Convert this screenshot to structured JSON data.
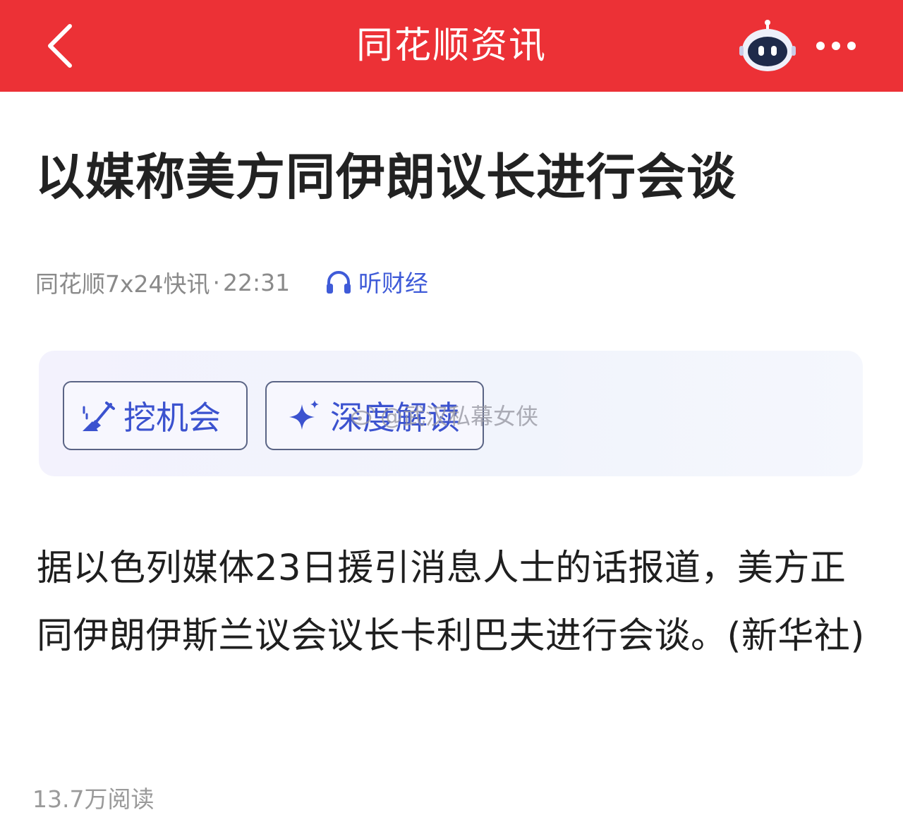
{
  "header": {
    "title": "同花顺资讯"
  },
  "article": {
    "title": "以媒称美方同伊朗议长进行会谈",
    "source": "同花顺7x24快讯",
    "separator": "·",
    "time": "22:31",
    "listen_label": "听财经",
    "body": "据以色列媒体23日援引消息人士的话报道，美方正同伊朗伊斯兰议会议长卡利巴夫进行会谈。(新华社)",
    "read_count": "13.7万阅读"
  },
  "ai_tools": {
    "dig_label": "挖机会",
    "deep_label": "深度解读"
  },
  "watermark": {
    "text": "@武汉私幕女侠"
  },
  "colors": {
    "header_bg": "#ec3136",
    "accent_blue": "#3b52cf",
    "title_text": "#222222",
    "meta_text": "#8a8a8a"
  },
  "icons": {
    "back": "chevron-left-icon",
    "robot": "robot-assistant-icon",
    "more": "more-dots-icon",
    "listen": "headphones-icon",
    "dig": "shovel-icon",
    "deep": "sparkle-icon",
    "watermark": "weibo-icon"
  }
}
